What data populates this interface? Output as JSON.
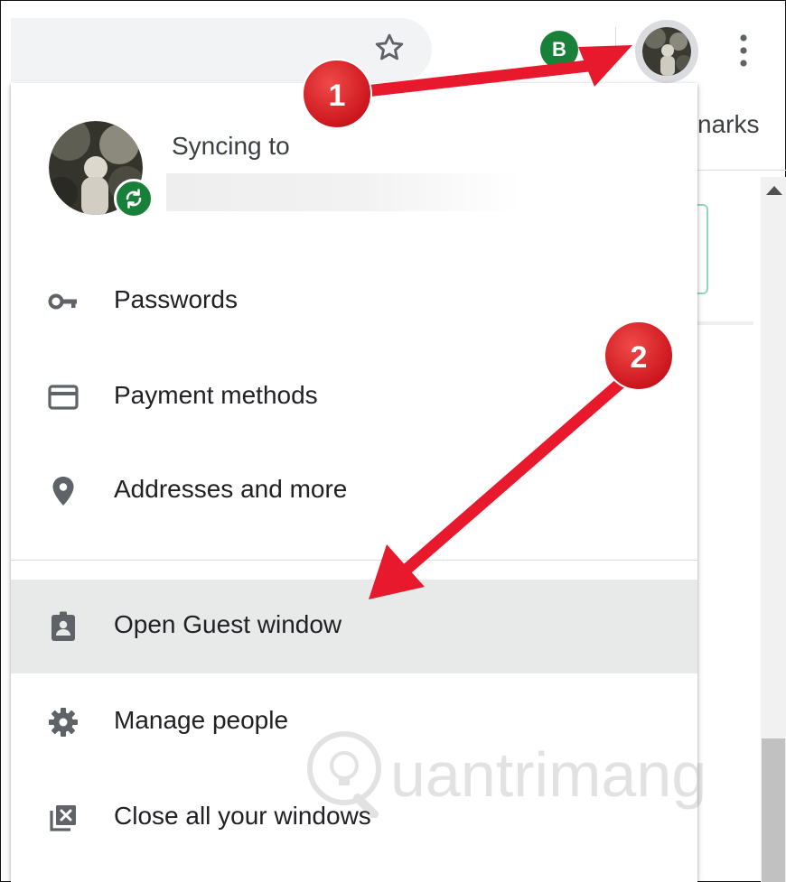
{
  "toolbar": {
    "icons": [
      "star-icon",
      "extension-icon",
      "avatar-icon",
      "more-vert-icon"
    ],
    "extension_letter": "B",
    "accent_green": "#188038"
  },
  "page": {
    "bookmarks_fragment": "narks"
  },
  "profile_menu": {
    "syncing_label": "Syncing to",
    "items": [
      {
        "label": "Passwords",
        "icon": "key-icon"
      },
      {
        "label": "Payment methods",
        "icon": "credit-card-icon"
      },
      {
        "label": "Addresses and more",
        "icon": "location-pin-icon"
      },
      {
        "label": "Open Guest window",
        "icon": "guest-badge-icon",
        "highlighted": true
      },
      {
        "label": "Manage people",
        "icon": "gear-icon"
      },
      {
        "label": "Close all your windows",
        "icon": "close-windows-icon"
      }
    ]
  },
  "annotations": {
    "step_1": "1",
    "step_2": "2",
    "color": "#e8192c"
  },
  "watermark": {
    "text": "uantrimang"
  }
}
